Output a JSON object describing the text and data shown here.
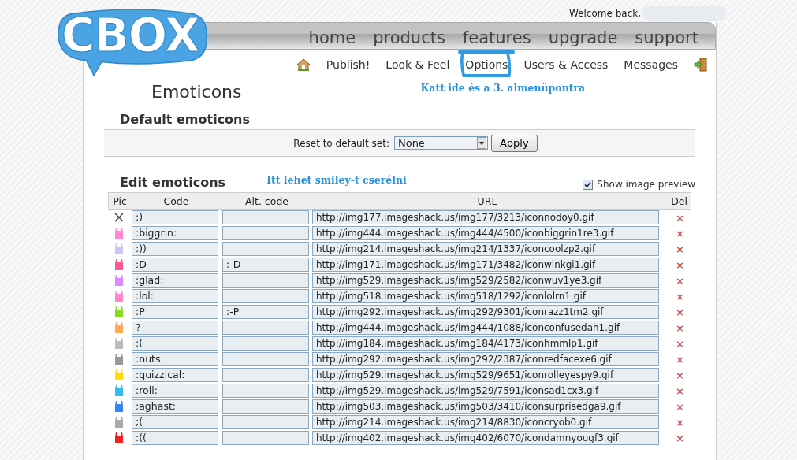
{
  "welcome": {
    "text": "Welcome back,"
  },
  "logo": {
    "text": "CBOX"
  },
  "nav": [
    "home",
    "products",
    "features",
    "upgrade",
    "support"
  ],
  "subnav": [
    {
      "label": "Publish!",
      "selected": false
    },
    {
      "label": "Look & Feel",
      "selected": false
    },
    {
      "label": "Options",
      "selected": true
    },
    {
      "label": "Users & Access",
      "selected": false
    },
    {
      "label": "Messages",
      "selected": false
    }
  ],
  "annotations": [
    "Katt ide és a 3. almenüpontra",
    "Itt lehet smiley-t cserélni"
  ],
  "title": "Emoticons",
  "default_section": {
    "heading": "Default emoticons",
    "label": "Reset to default set:",
    "select_value": "None",
    "button": "Apply"
  },
  "edit_section": {
    "heading": "Edit emoticons",
    "preview": {
      "label": "Show image preview",
      "checked": true
    }
  },
  "table": {
    "columns": [
      "Pic",
      "Code",
      "Alt. code",
      "URL",
      "Del"
    ],
    "rows": [
      {
        "pic": {
          "kind": "broken"
        },
        "code": ":)",
        "alt": "",
        "url": "http://img177.imageshack.us/img177/3213/iconnodoy0.gif",
        "del": "×"
      },
      {
        "pic": {
          "kind": "bunny",
          "color": "#ff88cc"
        },
        "code": ":biggrin:",
        "alt": "",
        "url": "http://img444.imageshack.us/img444/4500/iconbiggrin1re3.gif",
        "del": "×"
      },
      {
        "pic": {
          "kind": "bunny",
          "color": "#c8c8f0"
        },
        "code": ":))",
        "alt": "",
        "url": "http://img214.imageshack.us/img214/1337/iconcoolzp2.gif",
        "del": "×"
      },
      {
        "pic": {
          "kind": "bunny",
          "color": "#ff5599"
        },
        "code": ":D",
        "alt": ":-D",
        "url": "http://img171.imageshack.us/img171/3482/iconwinkgi1.gif",
        "del": "×"
      },
      {
        "pic": {
          "kind": "bunny",
          "color": "#dd88ff"
        },
        "code": ":glad:",
        "alt": "",
        "url": "http://img529.imageshack.us/img529/2582/iconwuv1ye3.gif",
        "del": "×"
      },
      {
        "pic": {
          "kind": "bunny",
          "color": "#ff88cc"
        },
        "code": ":lol:",
        "alt": "",
        "url": "http://img518.imageshack.us/img518/1292/iconlolrn1.gif",
        "del": "×"
      },
      {
        "pic": {
          "kind": "bunny",
          "color": "#88dd22"
        },
        "code": ":P",
        "alt": ":-P",
        "url": "http://img292.imageshack.us/img292/9301/iconrazz1tm2.gif",
        "del": "×"
      },
      {
        "pic": {
          "kind": "bunny",
          "color": "#ffaa55"
        },
        "code": "?",
        "alt": "",
        "url": "http://img444.imageshack.us/img444/1088/iconconfusedah1.gif",
        "del": "×"
      },
      {
        "pic": {
          "kind": "bunny",
          "color": "#bbbbbb"
        },
        "code": ":(",
        "alt": "",
        "url": "http://img184.imageshack.us/img184/4173/iconhmmlp1.gif",
        "del": "×"
      },
      {
        "pic": {
          "kind": "bunny",
          "color": "#999999"
        },
        "code": ":nuts:",
        "alt": "",
        "url": "http://img292.imageshack.us/img292/2387/iconredfacexe6.gif",
        "del": "×"
      },
      {
        "pic": {
          "kind": "bunny",
          "color": "#ffdd00"
        },
        "code": ":quizzical:",
        "alt": "",
        "url": "http://img529.imageshack.us/img529/9651/iconrolleyespy9.gif",
        "del": "×"
      },
      {
        "pic": {
          "kind": "bunny",
          "color": "#33bbee"
        },
        "code": ":roll:",
        "alt": "",
        "url": "http://img529.imageshack.us/img529/7591/iconsad1cx3.gif",
        "del": "×"
      },
      {
        "pic": {
          "kind": "bunny",
          "color": "#3388ee"
        },
        "code": ":aghast:",
        "alt": "",
        "url": "http://img503.imageshack.us/img503/3410/iconsurprisedga9.gif",
        "del": "×"
      },
      {
        "pic": {
          "kind": "bunny",
          "color": "#aaaaaa"
        },
        "code": ";(",
        "alt": "",
        "url": "http://img214.imageshack.us/img214/8830/iconcryob0.gif",
        "del": "×"
      },
      {
        "pic": {
          "kind": "bunny",
          "color": "#ee2222"
        },
        "code": ":((",
        "alt": "",
        "url": "http://img402.imageshack.us/img402/6070/icondamnyougf3.gif",
        "del": "×"
      }
    ]
  }
}
